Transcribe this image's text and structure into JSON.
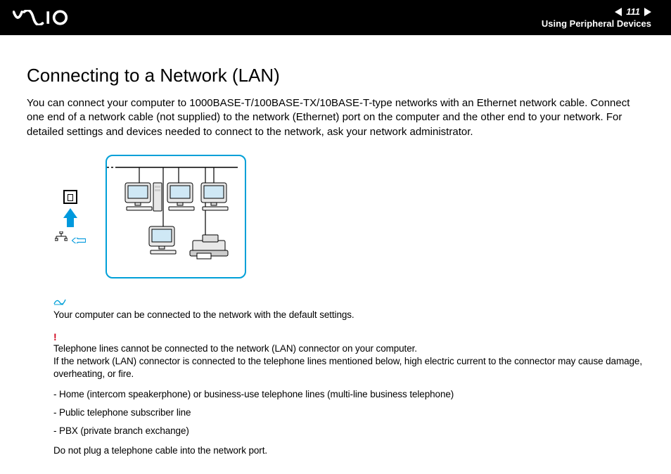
{
  "header": {
    "page_number": "111",
    "section_link": "Using Peripheral Devices"
  },
  "title": "Connecting to a Network (LAN)",
  "intro": "You can connect your computer to 1000BASE-T/100BASE-TX/10BASE-T-type networks with an Ethernet network cable. Connect one end of a network cable (not supplied) to the network (Ethernet) port on the computer and the other end to your network. For detailed settings and devices needed to connect to the network, ask your network administrator.",
  "note": {
    "icon_label": "note-pencil",
    "text": "Your computer can be connected to the network with the default settings."
  },
  "warning": {
    "icon": "!",
    "line1": "Telephone lines cannot be connected to the network (LAN) connector on your computer.",
    "line2": "If the network (LAN) connector is connected to the telephone lines mentioned below, high electric current to the connector may cause damage, overheating, or fire.",
    "items": [
      "Home (intercom speakerphone) or business-use telephone lines (multi-line business telephone)",
      "Public telephone subscriber line",
      "PBX (private branch exchange)"
    ],
    "final": "Do not plug a telephone cable into the network port."
  }
}
